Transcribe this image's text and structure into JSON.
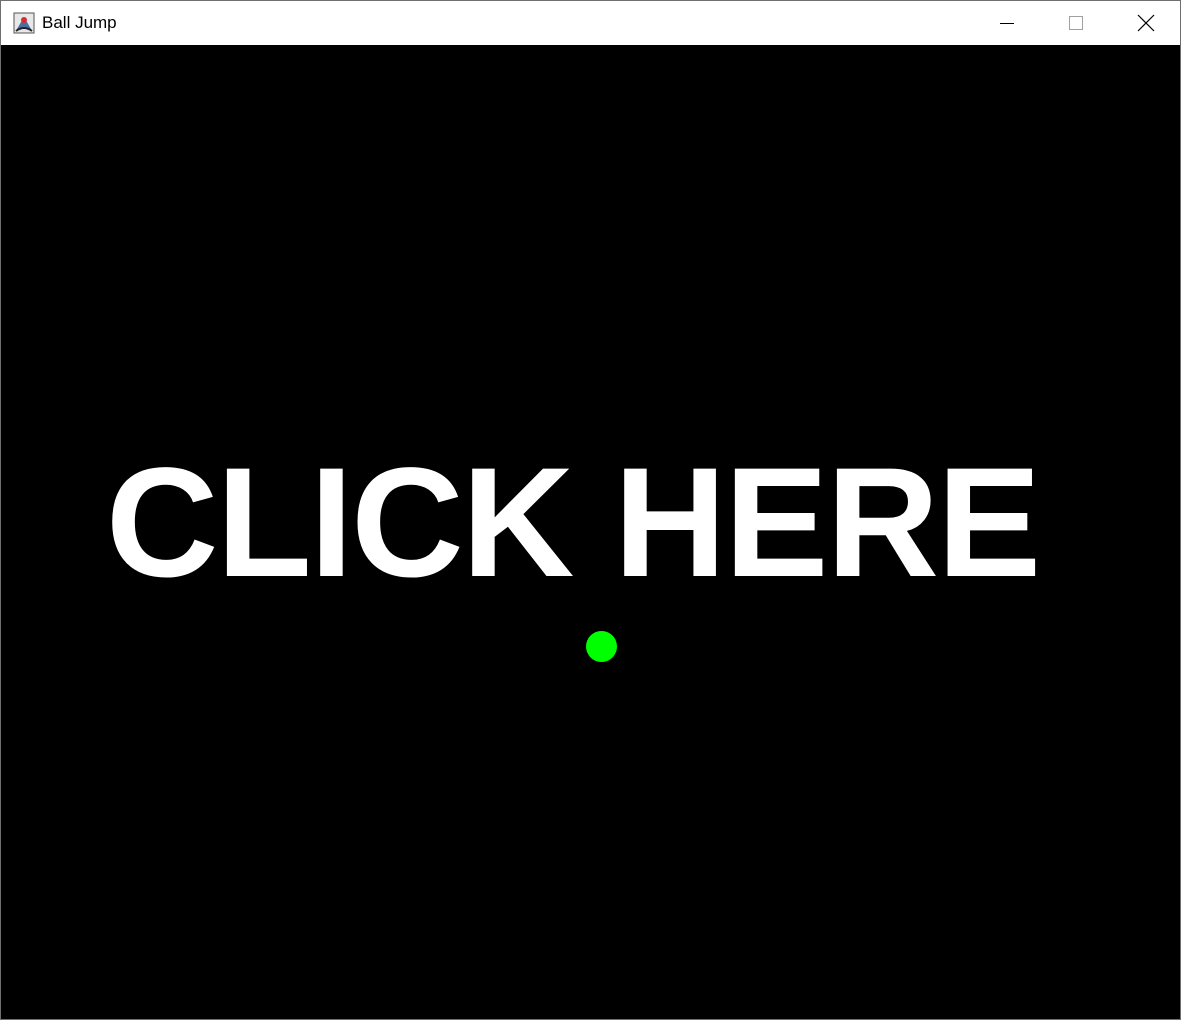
{
  "window": {
    "title": "Ball Jump",
    "icon": "java-app-icon"
  },
  "controls": {
    "minimize_icon": "minimize-icon",
    "maximize_icon": "maximize-icon",
    "close_icon": "close-icon"
  },
  "game": {
    "background_color": "#000000",
    "prompt": "CLICK HERE",
    "prompt_color": "#ffffff",
    "ball_color": "#00ff00"
  }
}
